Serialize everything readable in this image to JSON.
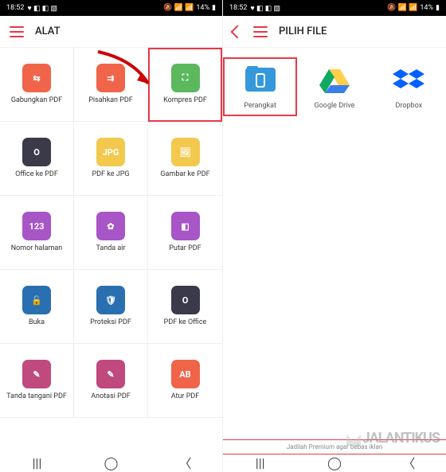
{
  "status": {
    "time": "18:52",
    "battery": "14%",
    "icons": [
      "♥",
      "◧",
      "◧",
      "▧"
    ],
    "right_icons": [
      "🔕",
      "📶",
      "📶",
      "🔋"
    ]
  },
  "left": {
    "header": "ALAT",
    "tools": [
      {
        "label": "Gabungkan PDF",
        "color": "#f06449",
        "glyph": "⇆"
      },
      {
        "label": "Pisahkan PDF",
        "color": "#f06449",
        "glyph": "⇉"
      },
      {
        "label": "Kompres PDF",
        "color": "#5cb85c",
        "glyph": "⛶"
      },
      {
        "label": "Office ke PDF",
        "color": "#3a3a4a",
        "glyph": "O"
      },
      {
        "label": "PDF ke JPG",
        "color": "#f2c94c",
        "glyph": "JPG"
      },
      {
        "label": "Gambar ke PDF",
        "color": "#f2c94c",
        "glyph": "🖼"
      },
      {
        "label": "Nomor halaman",
        "color": "#a855c7",
        "glyph": "123"
      },
      {
        "label": "Tanda air",
        "color": "#a855c7",
        "glyph": "✿"
      },
      {
        "label": "Putar PDF",
        "color": "#a855c7",
        "glyph": "◧"
      },
      {
        "label": "Buka",
        "color": "#2a6fb0",
        "glyph": "🔓"
      },
      {
        "label": "Proteksi PDF",
        "color": "#2a6fb0",
        "glyph": "🛡"
      },
      {
        "label": "PDF ke Office",
        "color": "#3a3a4a",
        "glyph": "O"
      },
      {
        "label": "Tanda tangani PDF",
        "color": "#c0497e",
        "glyph": "✎"
      },
      {
        "label": "Anotasi PDF",
        "color": "#c0497e",
        "glyph": "✎"
      },
      {
        "label": "Atur PDF",
        "color": "#f06449",
        "glyph": "AB"
      }
    ],
    "highlight_index": 2
  },
  "right": {
    "header": "PILIH FILE",
    "sources": [
      {
        "label": "Perangkat",
        "color": "#3498db",
        "type": "device"
      },
      {
        "label": "Google Drive",
        "color": "#4caf50",
        "type": "gdrive"
      },
      {
        "label": "Dropbox",
        "color": "#0061ff",
        "type": "dropbox"
      }
    ],
    "highlight_index": 0,
    "footer": "Jadilah Premium agar bebas iklan"
  },
  "watermark": "JALANTIKUS"
}
